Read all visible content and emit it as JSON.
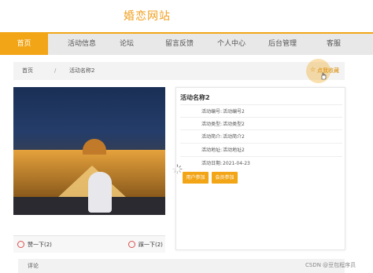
{
  "site": {
    "title": "婚恋网站"
  },
  "nav": {
    "items": [
      {
        "label": "首页",
        "active": true
      },
      {
        "label": "活动信息",
        "active": false
      },
      {
        "label": "论坛",
        "active": false
      },
      {
        "label": "留言反馈",
        "active": false
      },
      {
        "label": "个人中心",
        "active": false
      },
      {
        "label": "后台管理",
        "active": false
      },
      {
        "label": "客服",
        "active": false
      }
    ]
  },
  "breadcrumb": {
    "home": "首页",
    "separator": "/",
    "current": "活动名称2"
  },
  "favorite": {
    "label": "点我收藏",
    "icon": "star-icon"
  },
  "like_bar": {
    "like_label": "赞一下(2)",
    "dislike_label": "踩一下(2)"
  },
  "detail": {
    "title": "活动名称2",
    "rows": [
      {
        "key": "活动编号:",
        "value": "活动编号2"
      },
      {
        "key": "活动类型:",
        "value": "活动类型2"
      },
      {
        "key": "活动简介:",
        "value": "活动简介2"
      },
      {
        "key": "活动地址:",
        "value": "活动地址2"
      },
      {
        "key": "活动日期:",
        "value": "2021-04-23"
      }
    ],
    "buttons": {
      "user_join": "用户参加",
      "member_join": "会员参加"
    }
  },
  "comment": {
    "label": "评论"
  },
  "watermark": "CSDN @豆包程序员",
  "colors": {
    "accent": "#f2a516",
    "title": "#f0a020",
    "danger": "#d9534f"
  }
}
